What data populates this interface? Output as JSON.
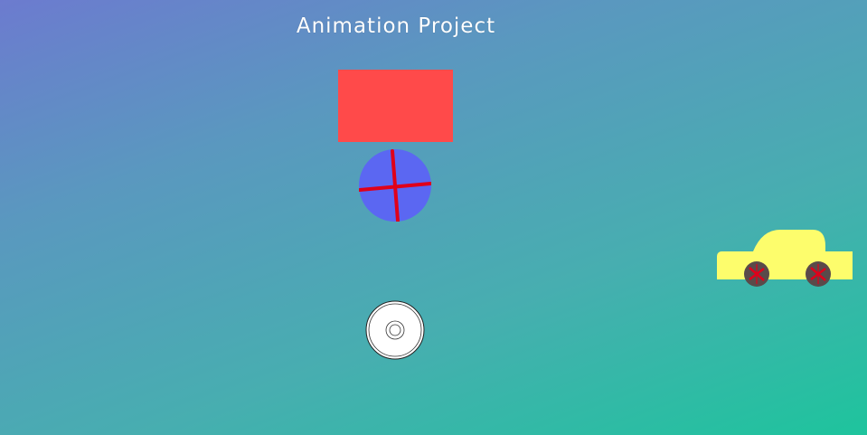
{
  "title": "Animation Project",
  "colors": {
    "rectangle": "#ff4a4a",
    "ball": "#5b67f2",
    "ball_cross": "#e0001a",
    "car_body": "#fdfd6c",
    "car_wheel": "#5a4a4a",
    "wheel_spoke": "#e0001a",
    "disc": "#ffffff"
  },
  "icons": {
    "rectangle": "red-rectangle",
    "ball": "rotating-ball-icon",
    "disc": "disc-icon",
    "car": "car-icon"
  }
}
